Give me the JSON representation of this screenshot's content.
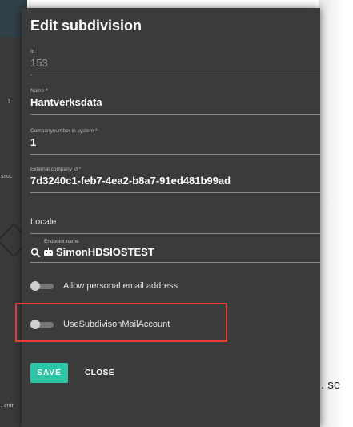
{
  "background": {
    "left_fragments": [
      "T",
      "ssoc",
      ", entr"
    ],
    "right_fragment": ". se"
  },
  "dialog": {
    "title": "Edit subdivision",
    "fields": {
      "id": {
        "label": "Id",
        "value": "153"
      },
      "name": {
        "label": "Name *",
        "value": "Hantverksdata"
      },
      "company_number": {
        "label": "Companynumber in system *",
        "value": "1"
      },
      "external_company_id": {
        "label": "External company id *",
        "value": "7d3240c1-feb7-4ea2-b8a7-91ed481b99ad"
      },
      "locale": {
        "label": "",
        "value": "Locale"
      },
      "endpoint": {
        "label": "Endpoint name",
        "value": "SimonHDSIOSTEST",
        "icons": [
          "search-icon",
          "robot-icon"
        ]
      }
    },
    "toggles": [
      {
        "label": "Allow personal email address",
        "on": false
      },
      {
        "label": "UseSubdivisonMailAccount",
        "on": false
      }
    ],
    "buttons": {
      "save": "SAVE",
      "close": "CLOSE"
    },
    "colors": {
      "background": "#3b3b3b",
      "accent": "#2ec4a6",
      "highlight": "#e23b3b"
    }
  }
}
